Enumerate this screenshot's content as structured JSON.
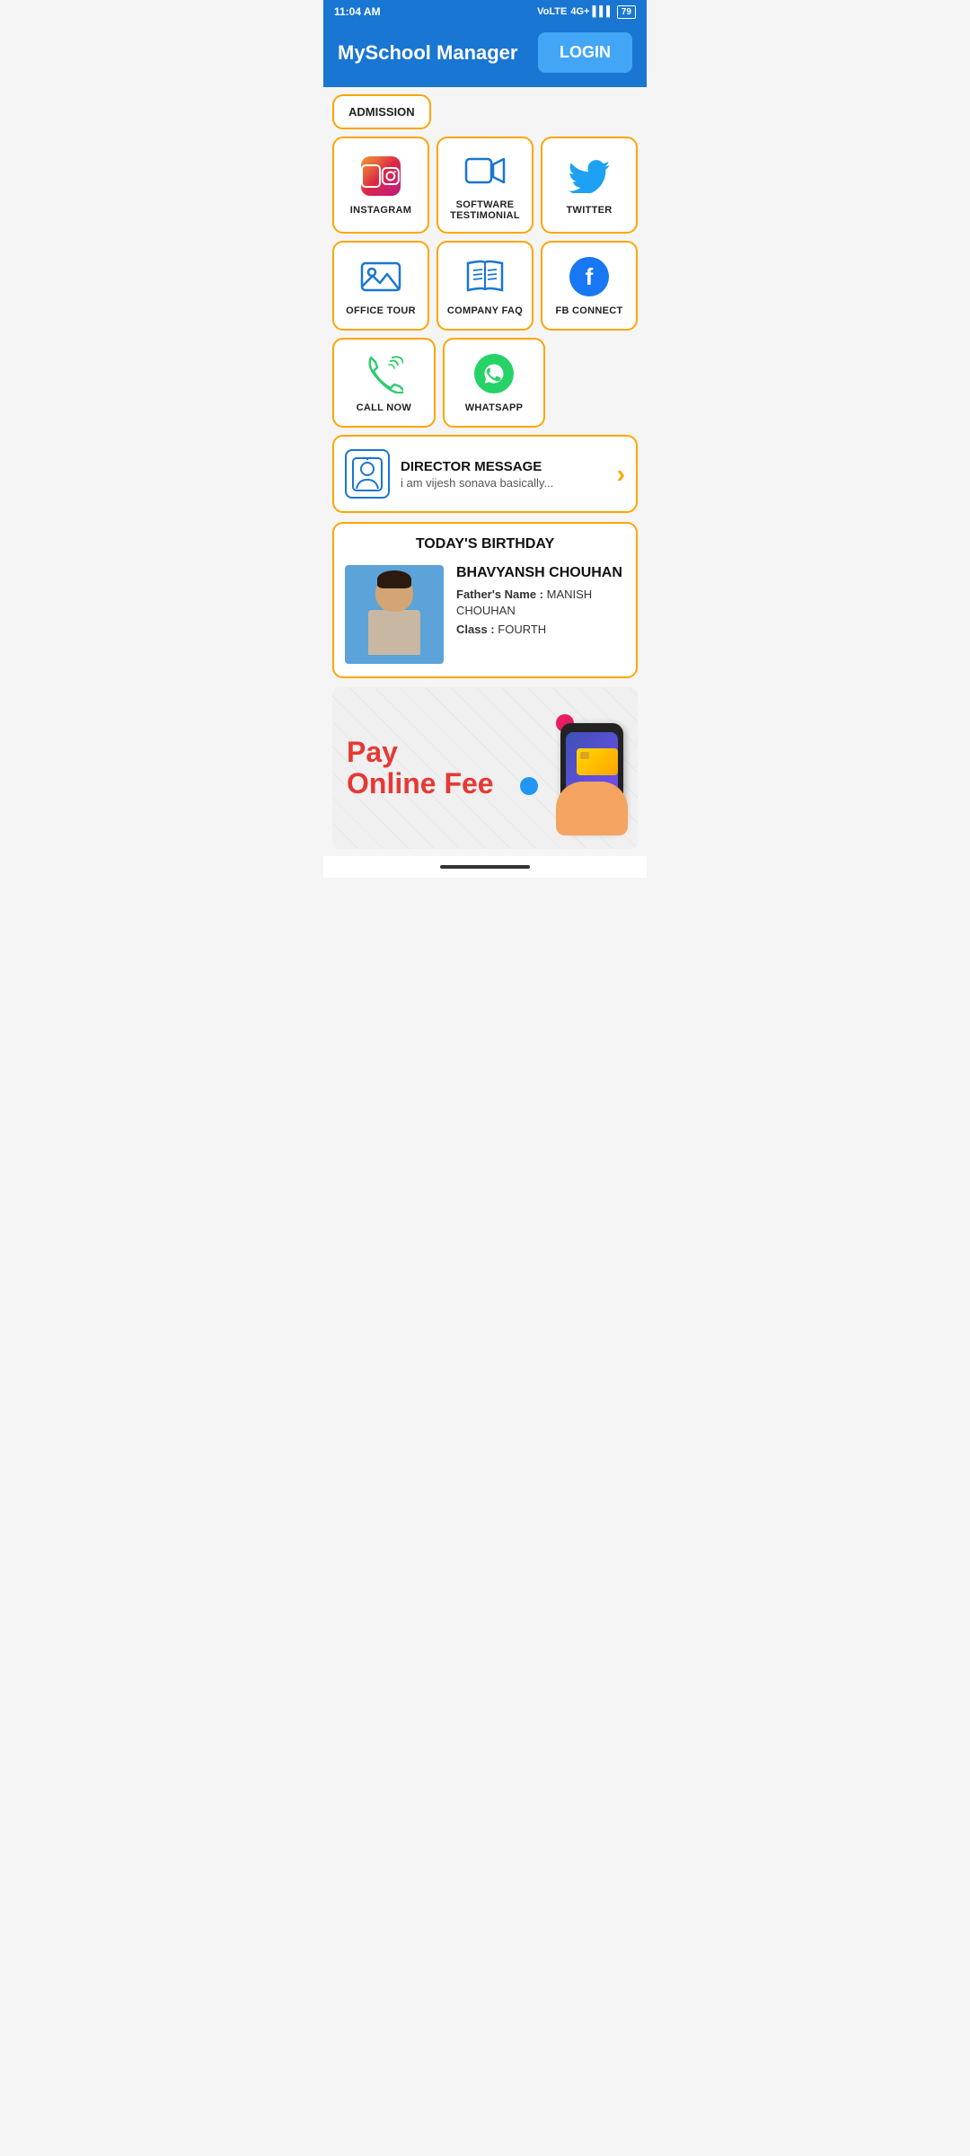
{
  "statusBar": {
    "time": "11:04 AM",
    "network": "4G+",
    "battery": "79"
  },
  "header": {
    "title": "MySchool Manager",
    "loginLabel": "LOGIN"
  },
  "admissionRow": {
    "label": "ADMISSION"
  },
  "gridRows": [
    {
      "items": [
        {
          "id": "instagram",
          "label": "INSTAGRAM",
          "icon": "instagram"
        },
        {
          "id": "software-testimonial",
          "label": "SOFTWARE\nTESTIMONIAL",
          "icon": "video-camera"
        },
        {
          "id": "twitter",
          "label": "TWITTER",
          "icon": "twitter"
        }
      ]
    },
    {
      "items": [
        {
          "id": "office-tour",
          "label": "OFFICE TOUR",
          "icon": "image"
        },
        {
          "id": "company-faq",
          "label": "COMPANY FAQ",
          "icon": "book"
        },
        {
          "id": "fb-connect",
          "label": "FB CONNECT",
          "icon": "facebook"
        }
      ]
    },
    {
      "items": [
        {
          "id": "call-now",
          "label": "CALL NOW",
          "icon": "phone"
        },
        {
          "id": "whatsapp",
          "label": "WHATSAPP",
          "icon": "whatsapp"
        }
      ]
    }
  ],
  "directorMessage": {
    "title": "DIRECTOR MESSAGE",
    "subtitle": "i am vijesh sonava basically..."
  },
  "birthdaySection": {
    "title": "TODAY'S BIRTHDAY",
    "name": "BHAVYANSH CHOUHAN",
    "fatherLabel": "Father's Name :",
    "fatherValue": "MANISH CHOUHAN",
    "classLabel": "Class :",
    "classValue": "FOURTH"
  },
  "payBanner": {
    "line1": "Pay",
    "line2": "Online Fee"
  },
  "colors": {
    "primary": "#1976D2",
    "accent": "#FFA500",
    "loginBtn": "#42A5F5"
  }
}
